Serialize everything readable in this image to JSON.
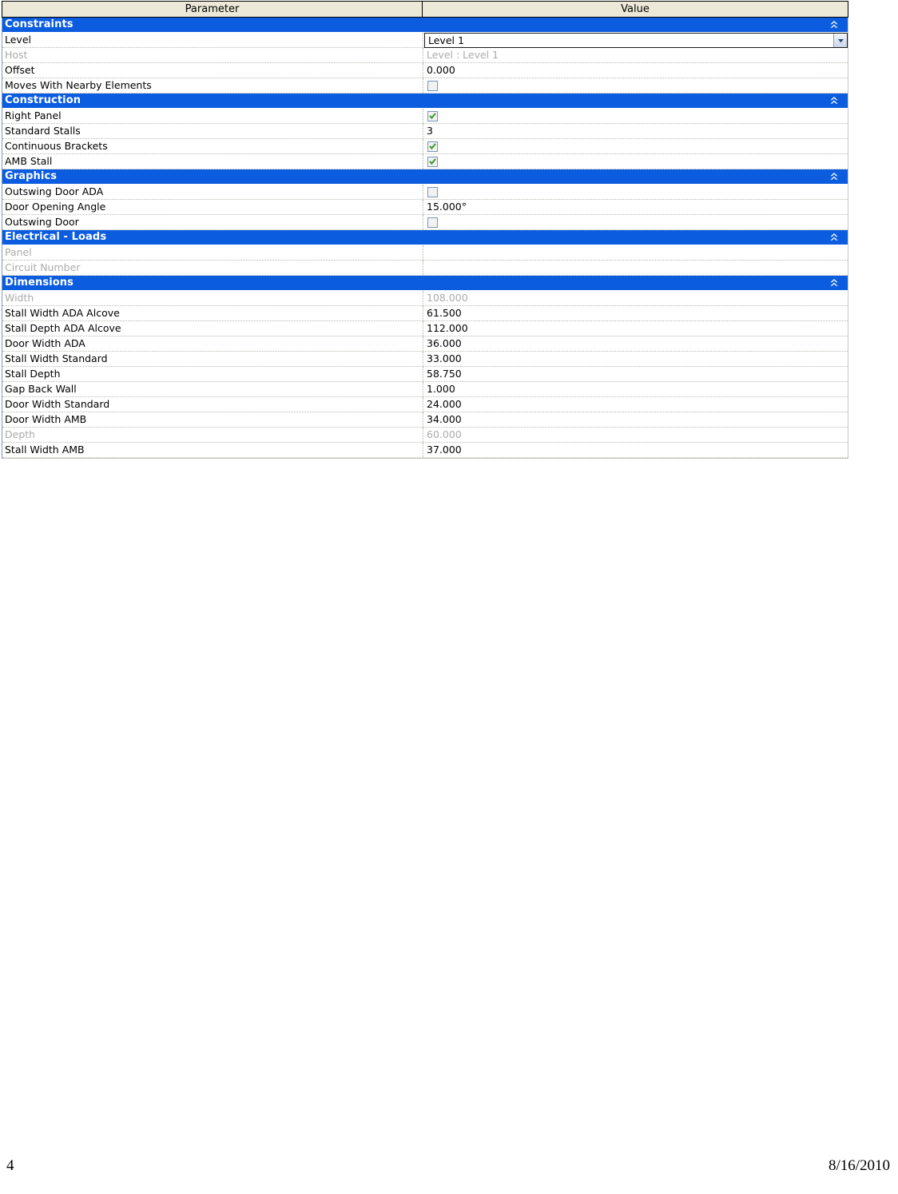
{
  "table": {
    "columns": [
      {
        "label": "Parameter"
      },
      {
        "label": "Value"
      }
    ],
    "collapse_icon": "double-chevron-up-icon",
    "dropdown_icon": "chevron-down-icon",
    "accent_blue": "#0B5CDF",
    "header_bg": "#ECE9D8",
    "check_green": "#3C9B2E",
    "disabled_text": "#ABABAB",
    "groups": [
      {
        "title": "Constraints",
        "rows": [
          {
            "name": "Level",
            "value": "Level 1",
            "type": "combo",
            "disabled": false
          },
          {
            "name": "Host",
            "value": "Level : Level 1",
            "type": "text",
            "disabled": true
          },
          {
            "name": "Offset",
            "value": "0.000",
            "type": "text",
            "disabled": false
          },
          {
            "name": "Moves With Nearby Elements",
            "value": "",
            "type": "checkbox",
            "checked": false,
            "disabled": false
          }
        ]
      },
      {
        "title": "Construction",
        "rows": [
          {
            "name": "Right Panel",
            "value": "",
            "type": "checkbox",
            "checked": true,
            "disabled": false
          },
          {
            "name": "Standard Stalls",
            "value": "3",
            "type": "text",
            "disabled": false
          },
          {
            "name": "Continuous Brackets",
            "value": "",
            "type": "checkbox",
            "checked": true,
            "disabled": false
          },
          {
            "name": "AMB Stall",
            "value": "",
            "type": "checkbox",
            "checked": true,
            "disabled": false
          }
        ]
      },
      {
        "title": "Graphics",
        "rows": [
          {
            "name": "Outswing Door ADA",
            "value": "",
            "type": "checkbox",
            "checked": false,
            "disabled": false
          },
          {
            "name": "Door Opening Angle",
            "value": "15.000°",
            "type": "text",
            "disabled": false
          },
          {
            "name": "Outswing Door",
            "value": "",
            "type": "checkbox",
            "checked": false,
            "disabled": false
          }
        ]
      },
      {
        "title": "Electrical - Loads",
        "rows": [
          {
            "name": "Panel",
            "value": "",
            "type": "text",
            "disabled": true
          },
          {
            "name": "Circuit Number",
            "value": "",
            "type": "text",
            "disabled": true
          }
        ]
      },
      {
        "title": "Dimensions",
        "rows": [
          {
            "name": "Width",
            "value": "108.000",
            "type": "text",
            "disabled": true
          },
          {
            "name": "Stall Width ADA Alcove",
            "value": "61.500",
            "type": "text",
            "disabled": false
          },
          {
            "name": "Stall Depth ADA Alcove",
            "value": "112.000",
            "type": "text",
            "disabled": false
          },
          {
            "name": "Door Width ADA",
            "value": "36.000",
            "type": "text",
            "disabled": false
          },
          {
            "name": "Stall Width Standard",
            "value": "33.000",
            "type": "text",
            "disabled": false
          },
          {
            "name": "Stall Depth",
            "value": "58.750",
            "type": "text",
            "disabled": false
          },
          {
            "name": "Gap Back Wall",
            "value": "1.000",
            "type": "text",
            "disabled": false
          },
          {
            "name": "Door Width Standard",
            "value": "24.000",
            "type": "text",
            "disabled": false
          },
          {
            "name": "Door Width AMB",
            "value": "34.000",
            "type": "text",
            "disabled": false
          },
          {
            "name": "Depth",
            "value": "60.000",
            "type": "text",
            "disabled": true
          },
          {
            "name": "Stall Width AMB",
            "value": "37.000",
            "type": "text",
            "disabled": false
          }
        ]
      }
    ]
  },
  "footer": {
    "page_number": "4",
    "date": "8/16/2010"
  }
}
